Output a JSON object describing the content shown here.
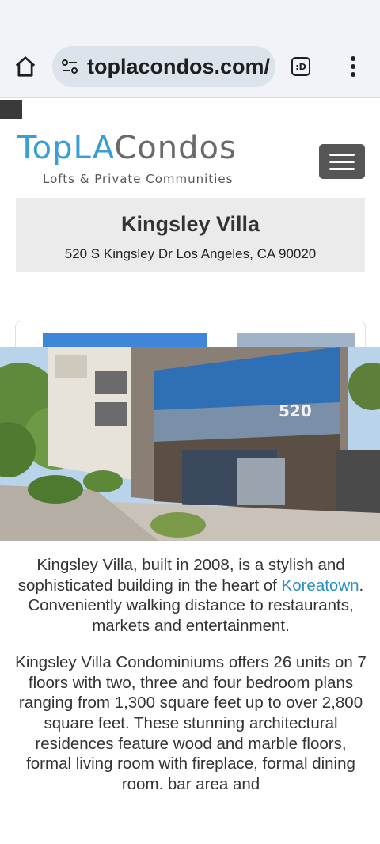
{
  "browser": {
    "url": "toplacondos.com/",
    "tab_count": ":D",
    "icons": [
      "home-icon",
      "site-settings-icon",
      "tab-switcher-icon",
      "more-vert-icon"
    ]
  },
  "site": {
    "logo": {
      "part_blue": "TopLA",
      "part_gray": "Condos",
      "tagline": "Lofts & Private Communities"
    },
    "colors": {
      "brand_blue": "#3a9ed6",
      "link": "#2a8fc1",
      "menu_button": "#555555",
      "title_bg": "#ebebeb"
    }
  },
  "listing": {
    "title": "Kingsley Villa",
    "address": "520 S Kingsley Dr Los Angeles, CA 90020",
    "photo_address_number": "520",
    "paragraph1": {
      "before_link": "Kingsley Villa, built in 2008, is a stylish and sophisticated building in the heart of ",
      "link_text": "Koreatown",
      "after_link": ". Conveniently walking distance to restaurants, markets and entertainment."
    },
    "paragraph2": "Kingsley Villa Condominiums offers 26 units on 7 floors with two, three and four bedroom plans ranging from 1,300 square feet up to over 2,800 square feet.  These stunning architectural residences feature wood and marble floors, formal living room with fireplace, formal dining room, bar area and"
  }
}
